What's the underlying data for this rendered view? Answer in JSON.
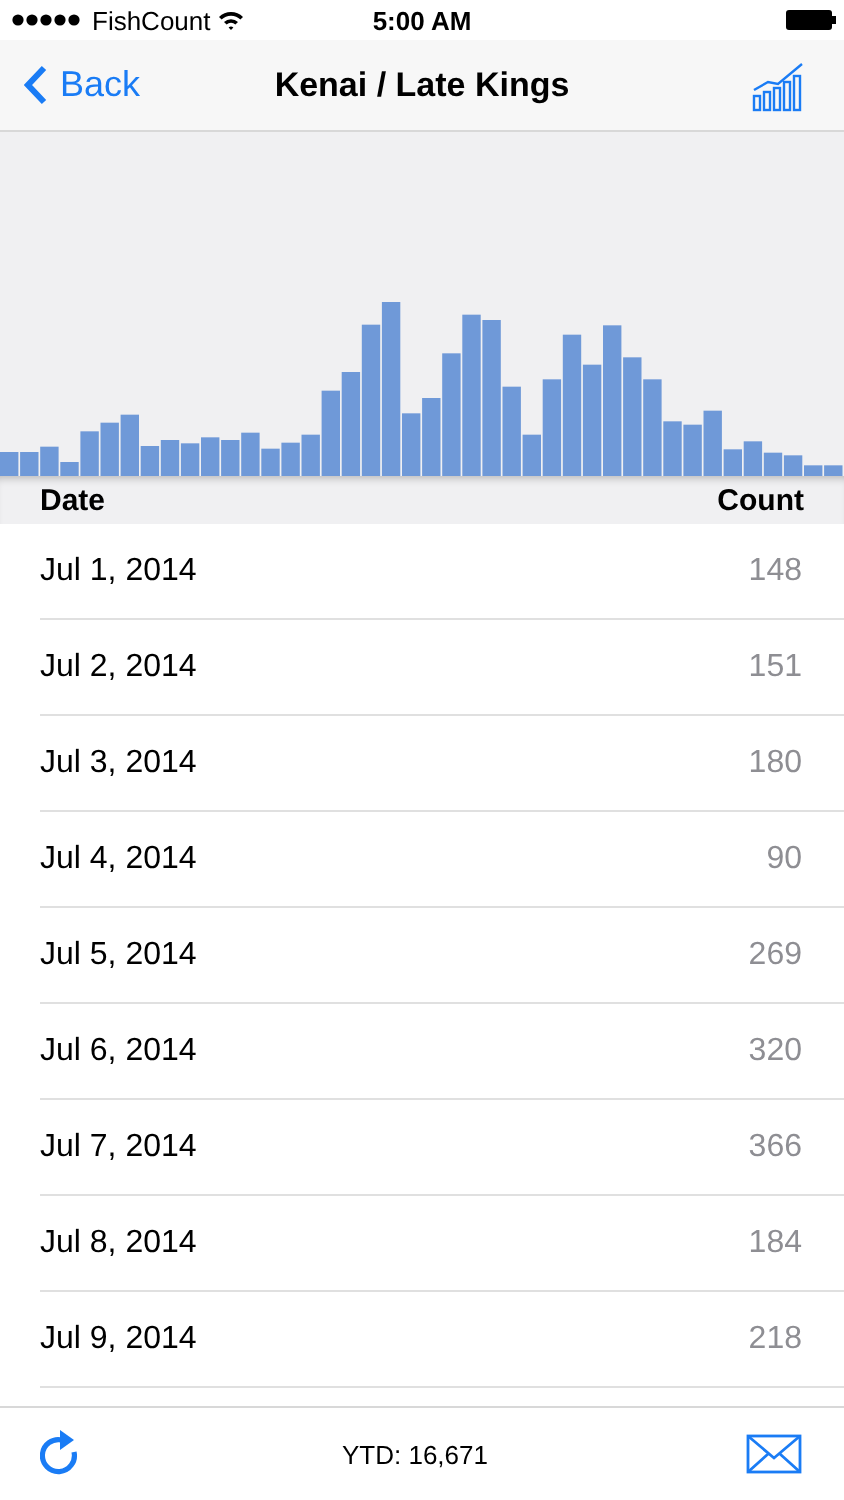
{
  "status_bar": {
    "carrier": "FishCount",
    "time": "5:00 AM"
  },
  "nav_bar": {
    "back": "Back",
    "title": "Kenai / Late Kings"
  },
  "table": {
    "columns": [
      "Date",
      "Count"
    ],
    "rows": [
      {
        "date": "Jul 1, 2014",
        "count": "148"
      },
      {
        "date": "Jul 2, 2014",
        "count": "151"
      },
      {
        "date": "Jul 3, 2014",
        "count": "180"
      },
      {
        "date": "Jul 4, 2014",
        "count": "90"
      },
      {
        "date": "Jul 5, 2014",
        "count": "269"
      },
      {
        "date": "Jul 6, 2014",
        "count": "320"
      },
      {
        "date": "Jul 7, 2014",
        "count": "366"
      },
      {
        "date": "Jul 8, 2014",
        "count": "184"
      },
      {
        "date": "Jul 9, 2014",
        "count": "218"
      }
    ]
  },
  "toolbar": {
    "total": "YTD: 16,671"
  }
}
